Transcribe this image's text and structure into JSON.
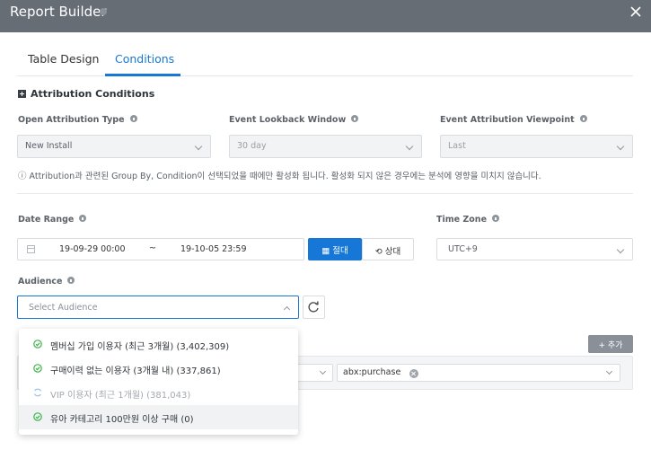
{
  "window": {
    "title": "Report Builder"
  },
  "tabs": [
    {
      "label": "Table Design",
      "active": false
    },
    {
      "label": "Conditions",
      "active": true
    }
  ],
  "attribution": {
    "section_title": "Attribution Conditions",
    "open_attribution_type": {
      "label": "Open Attribution Type",
      "value": "New Install"
    },
    "event_lookback_window": {
      "label": "Event Lookback Window",
      "value": "30 day"
    },
    "event_attribution_viewpoint": {
      "label": "Event Attribution Viewpoint",
      "value": "Last"
    },
    "note": "ⓘ Attribution과 관련된 Group By, Condition이 선택되었을 때에만 활성화 됩니다. 활성화 되지 않은 경우에는 분석에 영향을 미치지 않습니다."
  },
  "date_range": {
    "label": "Date Range",
    "start": "19-09-29 00:00",
    "separator": "~",
    "end": "19-10-05 23:59",
    "absolute_button": "절대",
    "relative_button": "상대"
  },
  "time_zone": {
    "label": "Time Zone",
    "value": "UTC+9"
  },
  "audience": {
    "label": "Audience",
    "placeholder": "Select Audience",
    "options": [
      {
        "label": "멤버십 가입 이용자 (최근 3개월) (3,402,309)",
        "status": "ready"
      },
      {
        "label": "구매이력 없는 이용자 (3개월 내) (337,861)",
        "status": "ready"
      },
      {
        "label": "VIP 이용자 (최근 1개월) (381,043)",
        "status": "loading"
      },
      {
        "label": "유아 카테고리 100만원 이상 구매 (0)",
        "status": "ready"
      }
    ]
  },
  "conditions": {
    "add_button": "+ 추가",
    "tag": "abx:purchase"
  },
  "colors": {
    "accent": "#1677d6",
    "titlebar": "#666d75",
    "check_green": "#3bb54a",
    "loading_blue": "#9fc3e8"
  }
}
